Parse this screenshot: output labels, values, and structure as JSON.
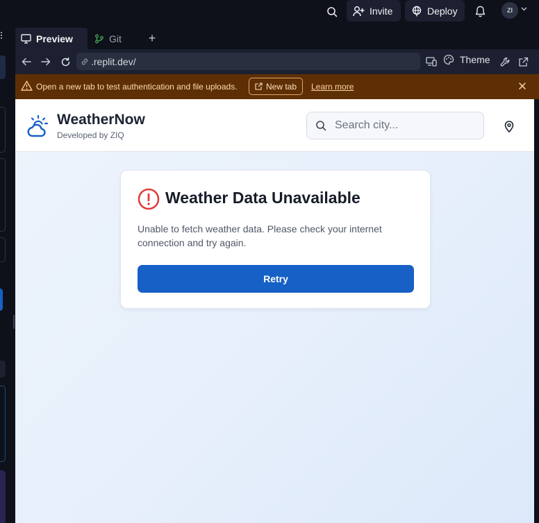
{
  "topbar": {
    "invite_label": "Invite",
    "deploy_label": "Deploy",
    "avatar_initials": "ZI"
  },
  "tabs": [
    {
      "label": "Preview",
      "icon": "monitor-icon",
      "active": true
    },
    {
      "label": "Git",
      "icon": "git-branch-icon",
      "active": false
    }
  ],
  "add_tab_label": "+",
  "urlbar": {
    "url": ".replit.dev/",
    "theme_label": "Theme"
  },
  "banner": {
    "message": "Open a new tab to test authentication and file uploads.",
    "new_tab_label": "New tab",
    "learn_more_label": "Learn more",
    "color": "#5e2f05"
  },
  "app": {
    "title": "WeatherNow",
    "subtitle": "Developed by ZIQ",
    "search_placeholder": "Search city..."
  },
  "error": {
    "title": "Weather Data Unavailable",
    "message": "Unable to fetch weather data. Please check your internet connection and try again.",
    "retry_label": "Retry",
    "accent": "#1660c6",
    "icon_color": "#e03e3e"
  }
}
